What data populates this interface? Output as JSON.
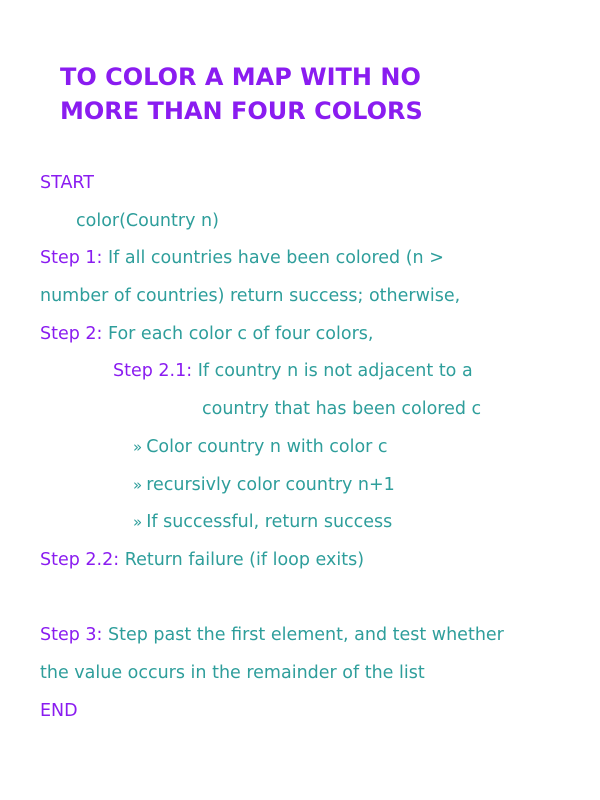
{
  "title": {
    "line1": "TO COLOR A MAP WITH NO",
    "line2": "MORE THAN FOUR COLORS"
  },
  "algorithm": {
    "start": "START",
    "signature": "color(Country n)",
    "step1": {
      "label": "Step 1:",
      "text_line1": " If all countries have been colored (n >",
      "text_line2": "number of countries) return success; otherwise,"
    },
    "step2": {
      "label": "Step 2:",
      "text": " For each color c of four colors,"
    },
    "step2_1": {
      "label": "Step 2.1:",
      "text_line1": " If country n is not adjacent to a",
      "text_line2": "country that has been colored c"
    },
    "bullets": [
      {
        "marker": "»",
        "text": "Color country n with color c"
      },
      {
        "marker": "»",
        "text": "recursivly color country n+1"
      },
      {
        "marker": "»",
        "text": "If successful, return success"
      }
    ],
    "step2_2": {
      "label": "Step 2.2:",
      "text": " Return failure (if loop exits)"
    },
    "step3": {
      "label": "Step 3:",
      "text_line1": " Step past the first element, and test whether",
      "text_line2": "the value occurs in the remainder of the list"
    },
    "end": "END"
  },
  "colors": {
    "keyword": "#8a1cf0",
    "body_text": "#2e9e9b",
    "background": "#ffffff"
  }
}
